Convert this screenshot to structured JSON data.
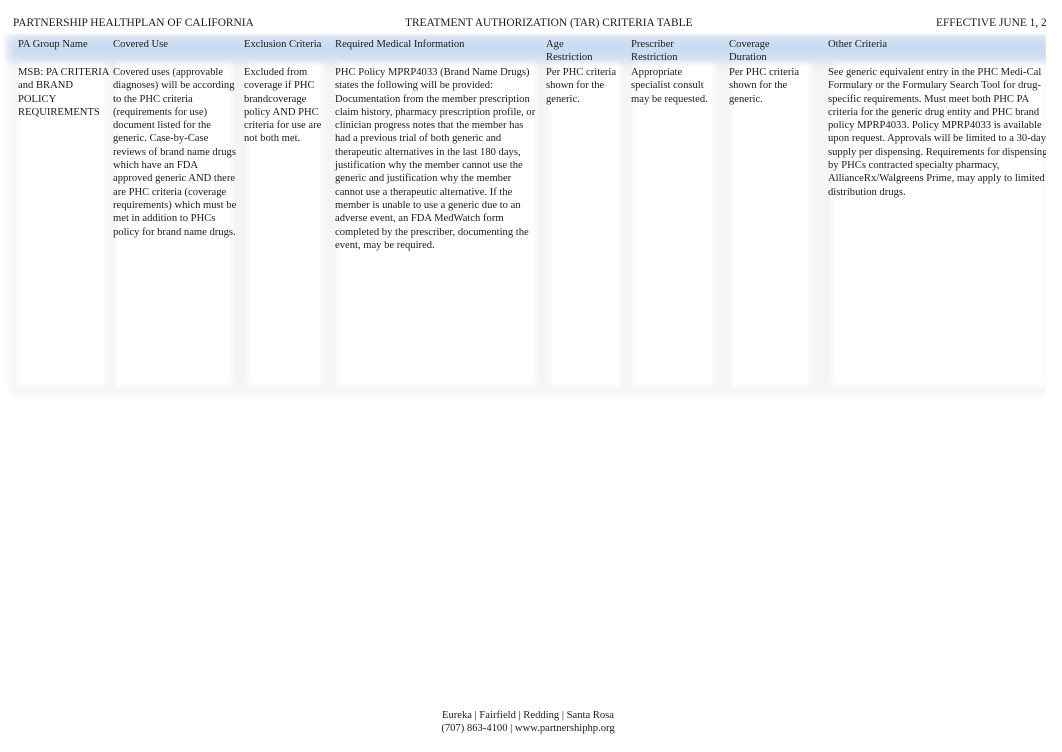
{
  "header": {
    "organization": "PARTNERSHIP HEALTHPLAN OF CALIFORNIA",
    "title": "TREATMENT AUTHORIZATION (TAR) CRITERIA TABLE",
    "effective": "EFFECTIVE JUNE 1, 2"
  },
  "table": {
    "columns": [
      "PA Group Name",
      "Covered Use",
      "Exclusion Criteria",
      "Required Medical Information",
      "Age Restriction",
      "Prescriber Restriction",
      "Coverage Duration",
      "Other Criteria"
    ],
    "rows": [
      {
        "pa_group_name_lines": [
          "MSB: PA CRITERIA",
          "and BRAND",
          "POLICY",
          "REQUIREMENTS"
        ],
        "covered_use": "Covered uses (approvable diagnoses) will be according to the PHC criteria (requirements for use) document listed for the generic. Case-by-Case reviews of brand name drugs which have an FDA approved generic AND there are PHC criteria (coverage requirements) which must be met in addition to PHCs policy for brand name drugs.",
        "exclusion_criteria": "Excluded from coverage if PHC brandcoverage policy AND PHC criteria for use are not both met.",
        "required_medical_information": "PHC Policy MPRP4033 (Brand Name Drugs) states the following will be provided: Documentation from the member prescription claim history, pharmacy prescription profile, or clinician progress notes that the member has had a previous trial of both generic and therapeutic alternatives in the last 180 days, justification why the member cannot use the generic and justification why the member cannot use a therapeutic alternative. If the member is unable to use a generic due to an adverse event, an FDA MedWatch form completed by the prescriber, documenting the event, may be required.",
        "age_restriction": "Per PHC criteria shown for the generic.",
        "prescriber_restriction": "Appropriate specialist consult may be requested.",
        "coverage_duration": "Per PHC criteria shown for the generic.",
        "other_criteria": "See generic equivalent entry in the PHC Medi-Cal Formulary or the Formulary Search Tool for drug-specific requirements. Must meet both PHC PA criteria for the generic drug entity and PHC brand policy MPRP4033. Policy MPRP4033 is available upon request. Approvals will be limited to a 30-day supply per dispensing. Requirements for dispensing by PHCs contracted specialty pharmacy, AllianceRx/Walgreens Prime, may apply to limited distribution drugs."
      }
    ]
  },
  "footer": {
    "locations": "Eureka | Fairfield | Redding | Santa Rosa",
    "contact": "(707) 863-4100 | www.partnershiphp.org"
  },
  "colors": {
    "header_band": "#c9dcf2",
    "text": "#1a1a1a"
  }
}
